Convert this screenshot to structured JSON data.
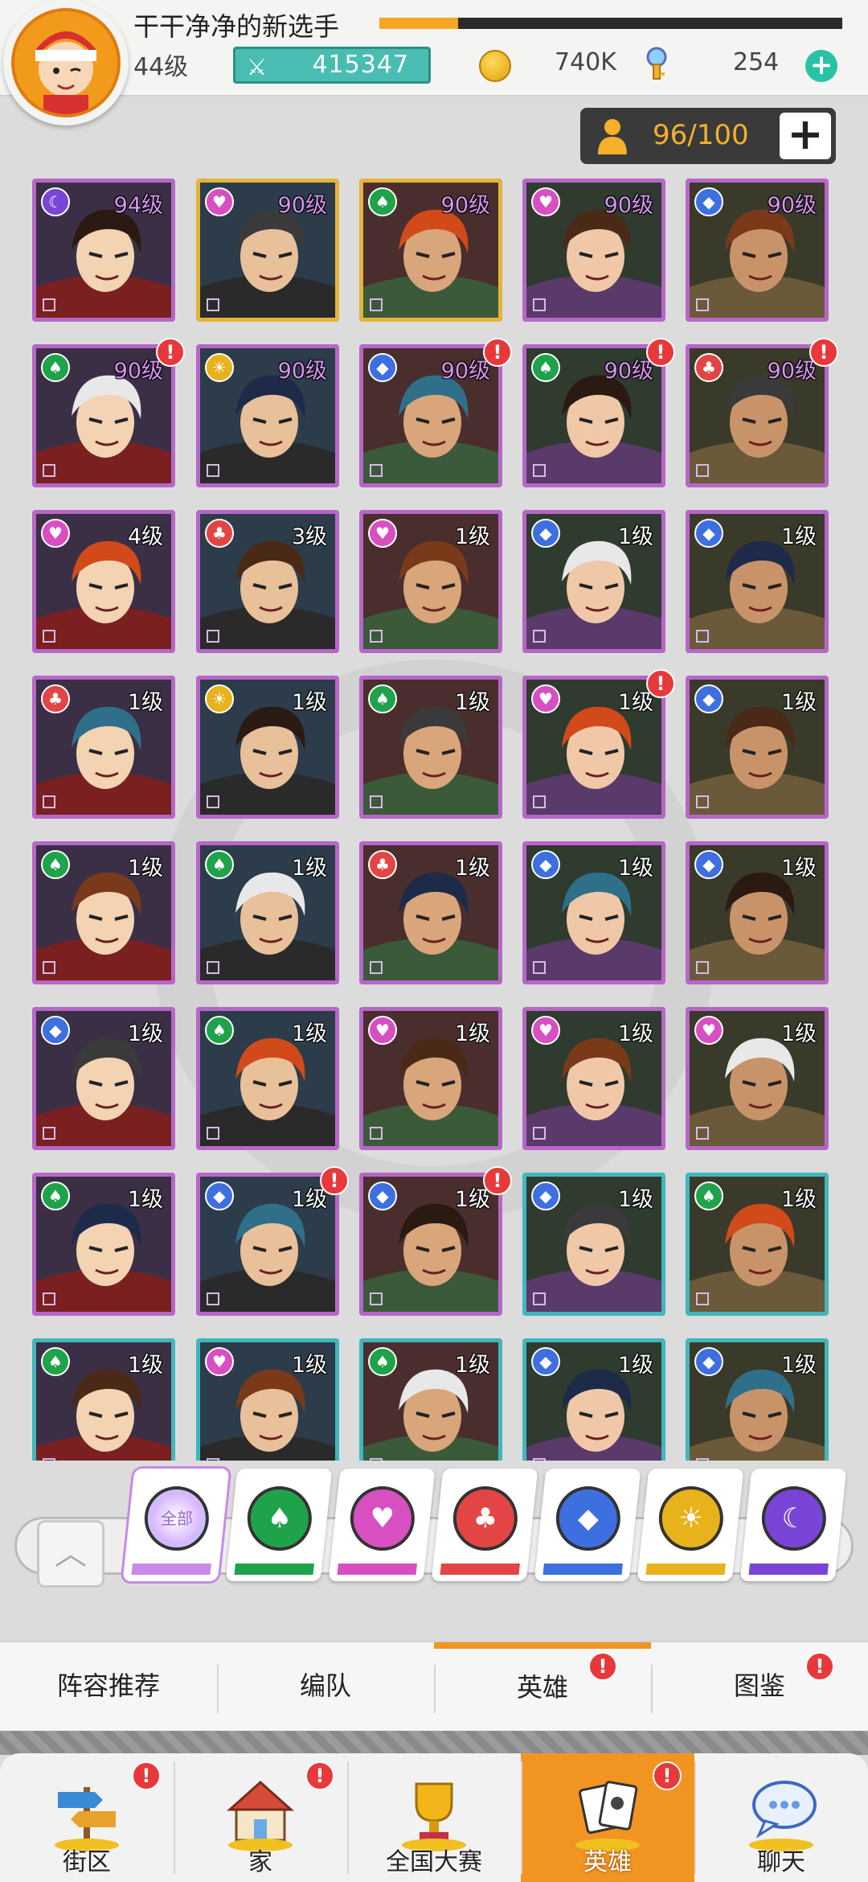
{
  "header": {
    "player_name": "干干净净的新选手",
    "level": "44级",
    "exp_percent": 17,
    "power": "415347",
    "coins": "740K",
    "gems": "254"
  },
  "capacity": {
    "text": "96/100"
  },
  "heroes": [
    {
      "level": "94级",
      "faction": "purple",
      "frame": "purple",
      "alert": false
    },
    {
      "level": "90级",
      "faction": "pink",
      "frame": "gold",
      "alert": false
    },
    {
      "level": "90级",
      "faction": "green",
      "frame": "gold",
      "alert": false
    },
    {
      "level": "90级",
      "faction": "pink",
      "frame": "purple",
      "alert": false
    },
    {
      "level": "90级",
      "faction": "blue",
      "frame": "purple",
      "alert": false
    },
    {
      "level": "90级",
      "faction": "green",
      "frame": "purple",
      "alert": true
    },
    {
      "level": "90级",
      "faction": "gold",
      "frame": "purple",
      "alert": false
    },
    {
      "level": "90级",
      "faction": "blue",
      "frame": "purple",
      "alert": true
    },
    {
      "level": "90级",
      "faction": "green",
      "frame": "purple",
      "alert": true
    },
    {
      "level": "90级",
      "faction": "red",
      "frame": "purple",
      "alert": true
    },
    {
      "level": "4级",
      "faction": "pink",
      "frame": "purple",
      "alert": false
    },
    {
      "level": "3级",
      "faction": "red",
      "frame": "purple",
      "alert": false
    },
    {
      "level": "1级",
      "faction": "pink",
      "frame": "purple",
      "alert": false
    },
    {
      "level": "1级",
      "faction": "blue",
      "frame": "purple",
      "alert": false
    },
    {
      "level": "1级",
      "faction": "blue",
      "frame": "purple",
      "alert": false
    },
    {
      "level": "1级",
      "faction": "red",
      "frame": "purple",
      "alert": false
    },
    {
      "level": "1级",
      "faction": "gold",
      "frame": "purple",
      "alert": false
    },
    {
      "level": "1级",
      "faction": "green",
      "frame": "purple",
      "alert": false
    },
    {
      "level": "1级",
      "faction": "pink",
      "frame": "purple",
      "alert": true
    },
    {
      "level": "1级",
      "faction": "blue",
      "frame": "purple",
      "alert": false
    },
    {
      "level": "1级",
      "faction": "green",
      "frame": "purple",
      "alert": false
    },
    {
      "level": "1级",
      "faction": "green",
      "frame": "purple",
      "alert": false
    },
    {
      "level": "1级",
      "faction": "red",
      "frame": "purple",
      "alert": false
    },
    {
      "level": "1级",
      "faction": "blue",
      "frame": "purple",
      "alert": false
    },
    {
      "level": "1级",
      "faction": "blue",
      "frame": "purple",
      "alert": false
    },
    {
      "level": "1级",
      "faction": "blue",
      "frame": "purple",
      "alert": false
    },
    {
      "level": "1级",
      "faction": "green",
      "frame": "purple",
      "alert": false
    },
    {
      "level": "1级",
      "faction": "pink",
      "frame": "purple",
      "alert": false
    },
    {
      "level": "1级",
      "faction": "pink",
      "frame": "purple",
      "alert": false
    },
    {
      "level": "1级",
      "faction": "pink",
      "frame": "purple",
      "alert": false
    },
    {
      "level": "1级",
      "faction": "green",
      "frame": "purple",
      "alert": false
    },
    {
      "level": "1级",
      "faction": "blue",
      "frame": "purple",
      "alert": true
    },
    {
      "level": "1级",
      "faction": "blue",
      "frame": "purple",
      "alert": true
    },
    {
      "level": "1级",
      "faction": "blue",
      "frame": "teal",
      "alert": false
    },
    {
      "level": "1级",
      "faction": "green",
      "frame": "teal",
      "alert": false
    },
    {
      "level": "1级",
      "faction": "green",
      "frame": "teal",
      "alert": false
    },
    {
      "level": "1级",
      "faction": "pink",
      "frame": "teal",
      "alert": false
    },
    {
      "level": "1级",
      "faction": "green",
      "frame": "teal",
      "alert": false
    },
    {
      "level": "1级",
      "faction": "blue",
      "frame": "teal",
      "alert": false
    },
    {
      "level": "1级",
      "faction": "blue",
      "frame": "teal",
      "alert": false
    }
  ],
  "faction_filters": [
    {
      "id": "all",
      "label": "全部",
      "color": "#c88ae6",
      "active": true
    },
    {
      "id": "green",
      "label": "",
      "color": "#1fa34a",
      "active": false
    },
    {
      "id": "pink",
      "label": "",
      "color": "#d84fc2",
      "active": false
    },
    {
      "id": "red",
      "label": "",
      "color": "#e34545",
      "active": false
    },
    {
      "id": "blue",
      "label": "",
      "color": "#3d6fe0",
      "active": false
    },
    {
      "id": "gold",
      "label": "",
      "color": "#e8b21c",
      "active": false
    },
    {
      "id": "purple",
      "label": "",
      "color": "#7a45d6",
      "active": false
    }
  ],
  "sub_tabs": [
    {
      "label": "阵容推荐",
      "active": false,
      "alert": false
    },
    {
      "label": "编队",
      "active": false,
      "alert": false
    },
    {
      "label": "英雄",
      "active": true,
      "alert": true
    },
    {
      "label": "图鉴",
      "active": false,
      "alert": true
    }
  ],
  "bottom_nav": [
    {
      "label": "街区",
      "icon": "signpost-icon",
      "active": false,
      "alert": true
    },
    {
      "label": "家",
      "icon": "house-icon",
      "active": false,
      "alert": true
    },
    {
      "label": "全国大赛",
      "icon": "trophy-icon",
      "active": false,
      "alert": false
    },
    {
      "label": "英雄",
      "icon": "cards-icon",
      "active": true,
      "alert": true
    },
    {
      "label": "聊天",
      "icon": "chat-bubble-icon",
      "active": false,
      "alert": false
    }
  ],
  "colors": {
    "accent_orange": "#f29422",
    "power_teal": "#49bdb2",
    "alert_red": "#e8383a",
    "frame_purple": "#b766c8",
    "frame_gold": "#e4b43a",
    "frame_teal": "#3fb7bd"
  }
}
